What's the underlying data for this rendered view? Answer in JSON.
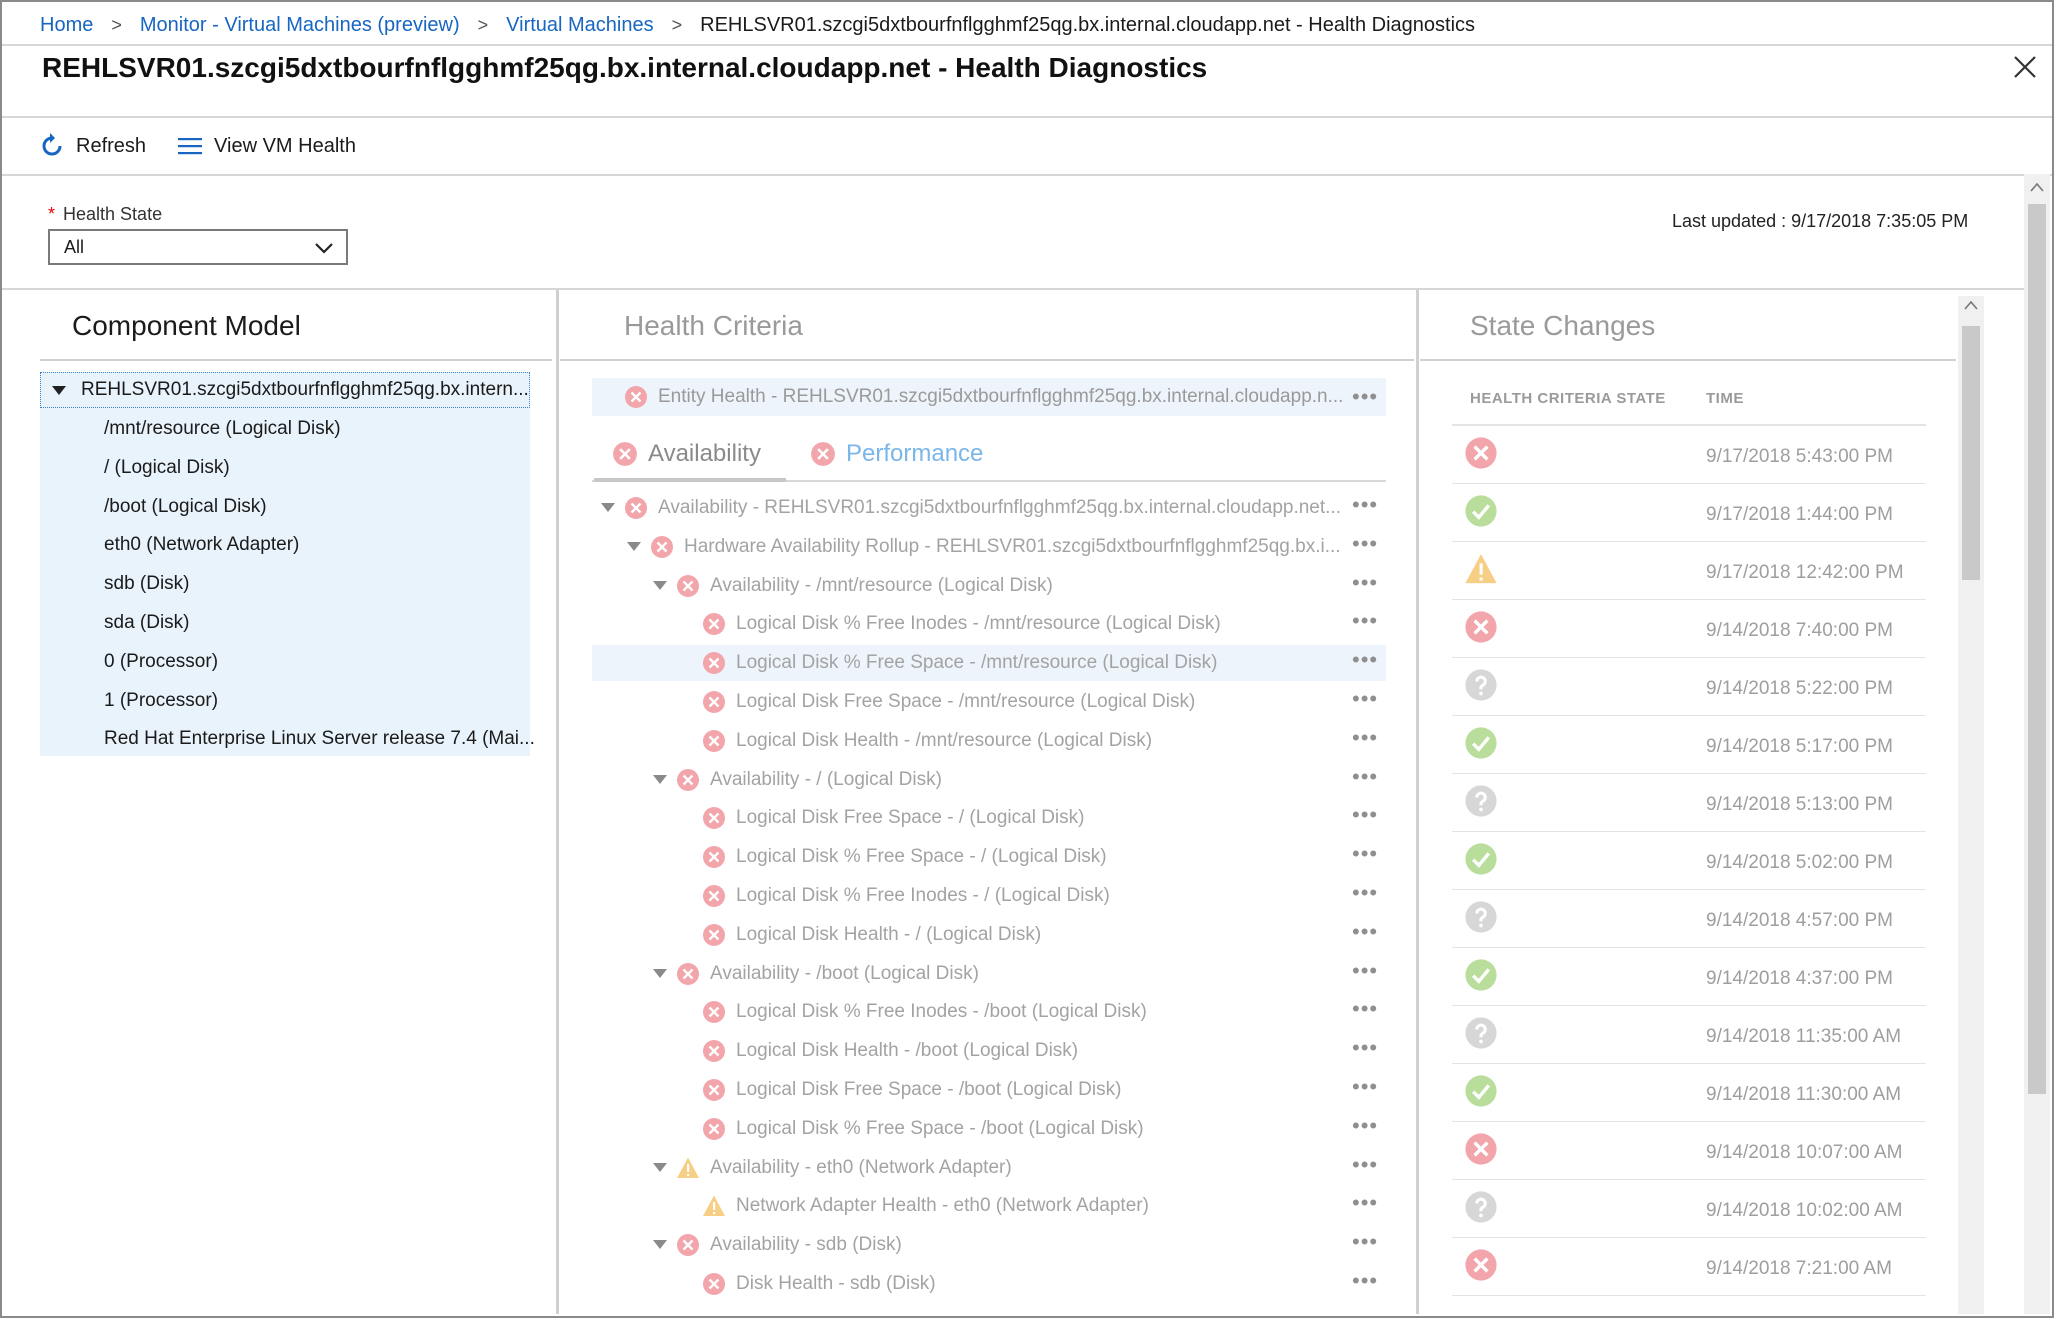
{
  "breadcrumb": {
    "items": [
      "Home",
      "Monitor - Virtual Machines (preview)",
      "Virtual Machines"
    ],
    "current": "REHLSVR01.szcgi5dxtbourfnflgghmf25qg.bx.internal.cloudapp.net - Health Diagnostics"
  },
  "header": {
    "title": "REHLSVR01.szcgi5dxtbourfnflgghmf25qg.bx.internal.cloudapp.net - Health Diagnostics"
  },
  "toolbar": {
    "refresh_label": "Refresh",
    "view_vm_health_label": "View VM Health"
  },
  "filter": {
    "label": "Health State",
    "required_mark": "*",
    "selected": "All"
  },
  "last_updated": "Last updated : 9/17/2018 7:35:05 PM",
  "component_model": {
    "title": "Component Model",
    "root": "REHLSVR01.szcgi5dxtbourfnflgghmf25qg.bx.intern...",
    "items": [
      "/mnt/resource (Logical Disk)",
      "/ (Logical Disk)",
      "/boot (Logical Disk)",
      "eth0 (Network Adapter)",
      "sdb (Disk)",
      "sda (Disk)",
      "0 (Processor)",
      "1 (Processor)",
      "Red Hat Enterprise Linux Server release 7.4 (Mai..."
    ]
  },
  "health_criteria": {
    "title": "Health Criteria",
    "entity": "Entity Health - REHLSVR01.szcgi5dxtbourfnflgghmf25qg.bx.internal.cloudapp.n...",
    "tabs": [
      "Availability",
      "Performance"
    ],
    "rows": [
      {
        "label": "Availability - REHLSVR01.szcgi5dxtbourfnflgghmf25qg.bx.internal.cloudapp.net...",
        "state": "error",
        "level": 0,
        "expand": true
      },
      {
        "label": "Hardware Availability Rollup - REHLSVR01.szcgi5dxtbourfnflgghmf25qg.bx.i...",
        "state": "error",
        "level": 1,
        "expand": true
      },
      {
        "label": "Availability - /mnt/resource (Logical Disk)",
        "state": "error",
        "level": 2,
        "expand": true
      },
      {
        "label": "Logical Disk % Free Inodes - /mnt/resource (Logical Disk)",
        "state": "error",
        "level": 3,
        "expand": false
      },
      {
        "label": "Logical Disk % Free Space - /mnt/resource (Logical Disk)",
        "state": "error",
        "level": 3,
        "expand": false,
        "highlight": true
      },
      {
        "label": "Logical Disk Free Space - /mnt/resource (Logical Disk)",
        "state": "error",
        "level": 3,
        "expand": false
      },
      {
        "label": "Logical Disk Health - /mnt/resource (Logical Disk)",
        "state": "error",
        "level": 3,
        "expand": false
      },
      {
        "label": "Availability - / (Logical Disk)",
        "state": "error",
        "level": 2,
        "expand": true
      },
      {
        "label": "Logical Disk Free Space - / (Logical Disk)",
        "state": "error",
        "level": 3,
        "expand": false
      },
      {
        "label": "Logical Disk % Free Space - / (Logical Disk)",
        "state": "error",
        "level": 3,
        "expand": false
      },
      {
        "label": "Logical Disk % Free Inodes - / (Logical Disk)",
        "state": "error",
        "level": 3,
        "expand": false
      },
      {
        "label": "Logical Disk Health - / (Logical Disk)",
        "state": "error",
        "level": 3,
        "expand": false
      },
      {
        "label": "Availability - /boot (Logical Disk)",
        "state": "error",
        "level": 2,
        "expand": true
      },
      {
        "label": "Logical Disk % Free Inodes - /boot (Logical Disk)",
        "state": "error",
        "level": 3,
        "expand": false
      },
      {
        "label": "Logical Disk Health - /boot (Logical Disk)",
        "state": "error",
        "level": 3,
        "expand": false
      },
      {
        "label": "Logical Disk Free Space - /boot (Logical Disk)",
        "state": "error",
        "level": 3,
        "expand": false
      },
      {
        "label": "Logical Disk % Free Space - /boot (Logical Disk)",
        "state": "error",
        "level": 3,
        "expand": false
      },
      {
        "label": "Availability - eth0 (Network Adapter)",
        "state": "warning",
        "level": 2,
        "expand": true
      },
      {
        "label": "Network Adapter Health - eth0 (Network Adapter)",
        "state": "warning",
        "level": 3,
        "expand": false
      },
      {
        "label": "Availability - sdb (Disk)",
        "state": "error",
        "level": 2,
        "expand": true
      },
      {
        "label": "Disk Health - sdb (Disk)",
        "state": "error",
        "level": 3,
        "expand": false
      }
    ]
  },
  "state_changes": {
    "title": "State Changes",
    "columns": [
      "HEALTH CRITERIA STATE",
      "TIME"
    ],
    "rows": [
      {
        "state": "error",
        "time": "9/17/2018 5:43:00 PM"
      },
      {
        "state": "ok",
        "time": "9/17/2018 1:44:00 PM"
      },
      {
        "state": "warning",
        "time": "9/17/2018 12:42:00 PM"
      },
      {
        "state": "error",
        "time": "9/14/2018 7:40:00 PM"
      },
      {
        "state": "unknown",
        "time": "9/14/2018 5:22:00 PM"
      },
      {
        "state": "ok",
        "time": "9/14/2018 5:17:00 PM"
      },
      {
        "state": "unknown",
        "time": "9/14/2018 5:13:00 PM"
      },
      {
        "state": "ok",
        "time": "9/14/2018 5:02:00 PM"
      },
      {
        "state": "unknown",
        "time": "9/14/2018 4:57:00 PM"
      },
      {
        "state": "ok",
        "time": "9/14/2018 4:37:00 PM"
      },
      {
        "state": "unknown",
        "time": "9/14/2018 11:35:00 AM"
      },
      {
        "state": "ok",
        "time": "9/14/2018 11:30:00 AM"
      },
      {
        "state": "error",
        "time": "9/14/2018 10:07:00 AM"
      },
      {
        "state": "unknown",
        "time": "9/14/2018 10:02:00 AM"
      },
      {
        "state": "error",
        "time": "9/14/2018 7:21:00 AM"
      }
    ]
  },
  "colors": {
    "link": "#1766c2",
    "error": "#f2a5aa",
    "ok": "#b9dd9a",
    "warning": "#f6cf85",
    "unknown": "#d7d7d7"
  }
}
